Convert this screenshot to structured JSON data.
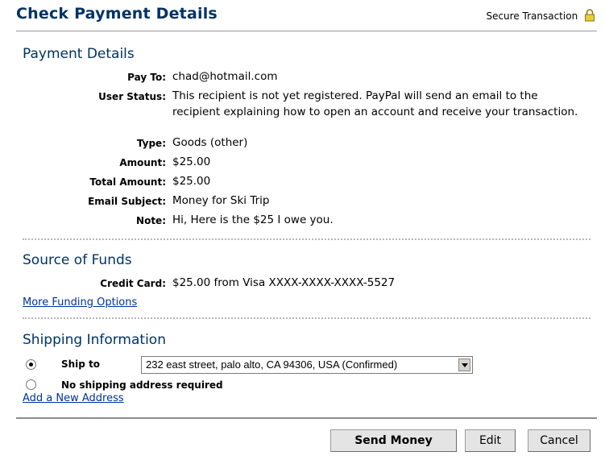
{
  "header": {
    "title": "Check Payment Details",
    "secure_text": "Secure Transaction",
    "lock_icon": "lock-icon"
  },
  "payment_details": {
    "title": "Payment Details",
    "rows": [
      {
        "label": "Pay To:",
        "value": "chad@hotmail.com"
      },
      {
        "label": "User Status:",
        "value": "This recipient is not yet registered. PayPal will send an email to the recipient explaining how to open an account and receive your transaction."
      },
      {
        "label": "Type:",
        "value": "Goods (other)"
      },
      {
        "label": "Amount:",
        "value": "$25.00"
      },
      {
        "label": "Total Amount:",
        "value": "$25.00"
      },
      {
        "label": "Email Subject:",
        "value": "Money for Ski Trip"
      },
      {
        "label": "Note:",
        "value": "Hi, Here is the $25 I owe you."
      }
    ]
  },
  "source_of_funds": {
    "title": "Source of Funds",
    "label": "Credit Card:",
    "value": "$25.00 from Visa XXXX-XXXX-XXXX-5527",
    "link": "More Funding Options"
  },
  "shipping": {
    "title": "Shipping Information",
    "option_ship_to": "Ship to",
    "address_selected": "232 east street, palo alto, CA 94306, USA (Confirmed)",
    "option_no_shipping": "No shipping address required",
    "add_link": "Add a New Address"
  },
  "actions": {
    "send": "Send Money",
    "edit": "Edit",
    "cancel": "Cancel"
  }
}
